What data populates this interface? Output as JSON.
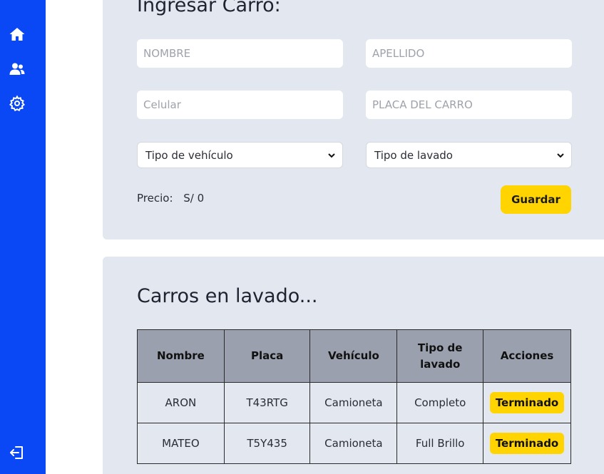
{
  "sidebar": {
    "items": [
      {
        "icon": "home-icon"
      },
      {
        "icon": "users-icon"
      },
      {
        "icon": "gear-icon"
      }
    ],
    "logout_icon": "logout-icon",
    "color": "#0a47f5"
  },
  "form": {
    "title": "Ingresar Carro:",
    "nombre_placeholder": "NOMBRE",
    "apellido_placeholder": "APELLIDO",
    "celular_placeholder": "Celular",
    "placa_placeholder": "PLACA DEL CARRO",
    "vehicle_type_selected": "Tipo de vehículo",
    "wash_type_selected": "Tipo de lavado",
    "price_label": "Precio:",
    "price_value": "S/ 0",
    "save_label": "Guardar"
  },
  "table": {
    "title": "Carros en lavado...",
    "headers": [
      "Nombre",
      "Placa",
      "Vehículo",
      "Tipo de lavado",
      "Acciones"
    ],
    "rows": [
      {
        "nombre": "ARON",
        "placa": "T43RTG",
        "vehiculo": "Camioneta",
        "tipo": "Completo",
        "accion": "Terminado"
      },
      {
        "nombre": "MATEO",
        "placa": "T5Y435",
        "vehiculo": "Camioneta",
        "tipo": "Full Brillo",
        "accion": "Terminado"
      }
    ]
  },
  "colors": {
    "accent": "#ffd400",
    "card_bg": "#e3e7f0",
    "header_bg": "#9aa0ad"
  }
}
